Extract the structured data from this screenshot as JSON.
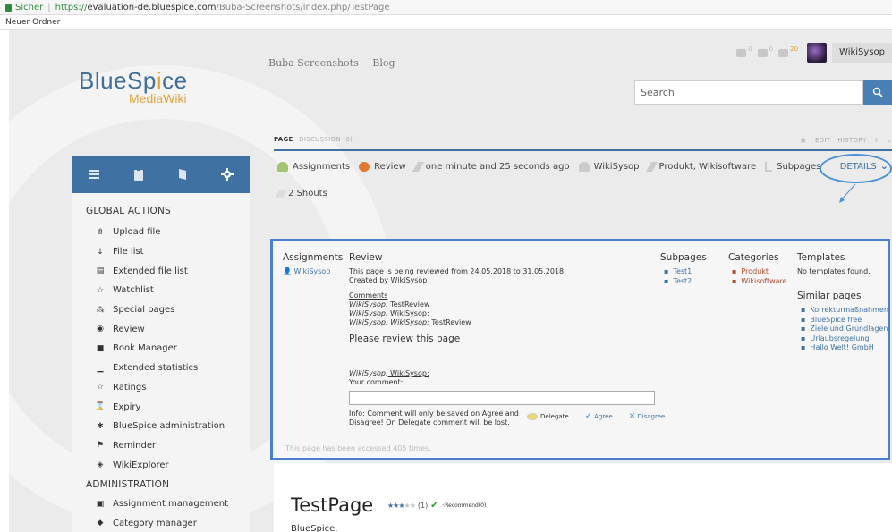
{
  "browser": {
    "secure_label": "Sicher",
    "url_proto": "https://",
    "url_host": "evaluation-de.bluespice.com",
    "url_path": "/Buba-Screenshots/index.php/TestPage",
    "bookmark": "Neuer Ordner"
  },
  "logo": {
    "main_a": "BlueSp",
    "main_accent": "i",
    "main_b": "ce",
    "sub": "MediaWiki"
  },
  "topnav": [
    "Buba Screenshots",
    "Blog"
  ],
  "user": {
    "name": "WikiSysop",
    "counts": [
      "0",
      "0",
      "20"
    ]
  },
  "search": {
    "placeholder": "Search"
  },
  "sidebar": {
    "tools": [
      "menu-icon",
      "clipboard-icon",
      "book-icon",
      "gear-icon"
    ],
    "global_heading": "GLOBAL ACTIONS",
    "global_items": [
      {
        "label": "Upload file",
        "icon": "upload-icon"
      },
      {
        "label": "File list",
        "icon": "sort-icon"
      },
      {
        "label": "Extended file list",
        "icon": "list-icon"
      },
      {
        "label": "Watchlist",
        "icon": "star-icon"
      },
      {
        "label": "Special pages",
        "icon": "special-icon"
      },
      {
        "label": "Review",
        "icon": "eye-icon"
      },
      {
        "label": "Book Manager",
        "icon": "book-icon"
      },
      {
        "label": "Extended statistics",
        "icon": "chart-icon"
      },
      {
        "label": "Ratings",
        "icon": "star-icon"
      },
      {
        "label": "Expiry",
        "icon": "hourglass-icon"
      },
      {
        "label": "BlueSpice administration",
        "icon": "gear-icon"
      },
      {
        "label": "Reminder",
        "icon": "flag-icon"
      },
      {
        "label": "WikiExplorer",
        "icon": "explorer-icon"
      }
    ],
    "admin_heading": "ADMINISTRATION",
    "admin_items": [
      {
        "label": "Assignment management",
        "icon": "assign-icon"
      },
      {
        "label": "Category manager",
        "icon": "category-icon"
      }
    ]
  },
  "page_tabs": {
    "page": "PAGE",
    "discussion": "DISCUSSION (0)"
  },
  "page_actions": {
    "edit": "EDIT",
    "history": "HISTORY"
  },
  "flyoutbar": {
    "assignments": "Assignments",
    "review": "Review",
    "time": "one minute and 25 seconds ago",
    "author": "WikiSysop",
    "categories": "Produkt, Wikisoftware",
    "subpages": "Subpages",
    "details": "DETAILS",
    "shouts": "2 Shouts"
  },
  "flyout": {
    "assignments": {
      "heading": "Assignments",
      "user": "WikiSysop"
    },
    "review": {
      "heading": "Review",
      "line1": "This page is being reviewed from 24.05.2018 to 31.05.2018.",
      "line2": "Created by WikiSysop",
      "comments_label": "Comments",
      "comments": [
        {
          "user": "WikiSysop:",
          "text": " TestReview"
        },
        {
          "user": "WikiSysop:",
          "text": " WikiSysop:"
        },
        {
          "user": "WikiSysop: WikiSysop:",
          "text": " TestReview"
        }
      ],
      "please": "Please review this page",
      "current_user": "WikiSysop:",
      "current_link": " WikiSysop:",
      "your_comment": "Your comment:",
      "info": "Info: Comment will only be saved on Agree and Disagree! On Delegate comment will be lost.",
      "delegate": "Delegate",
      "agree": "Agree",
      "disagree": "Disagree"
    },
    "subpages": {
      "heading": "Subpages",
      "items": [
        "Test1",
        "Test2"
      ]
    },
    "categories": {
      "heading": "Categories",
      "items": [
        "Produkt",
        "Wikisoftware"
      ]
    },
    "templates": {
      "heading": "Templates",
      "none": "No templates found."
    },
    "similar": {
      "heading": "Similar pages",
      "items": [
        "Korrekturmaßnahmen",
        "BlueSpice free",
        "Ziele und Grundlagen",
        "Urlaubsregelung",
        "Hallo Welt! GmbH"
      ]
    },
    "accessed": "This page has been accessed 405 times."
  },
  "article": {
    "title": "TestPage",
    "rating_count": "(1)",
    "rating_value": 3,
    "rating_max": 5,
    "recommend": "Recommend(0)",
    "body": "BlueSpice."
  },
  "colors": {
    "primary": "#3f72a3",
    "accent": "#e8a33a",
    "highlight": "#4a7fcf"
  }
}
